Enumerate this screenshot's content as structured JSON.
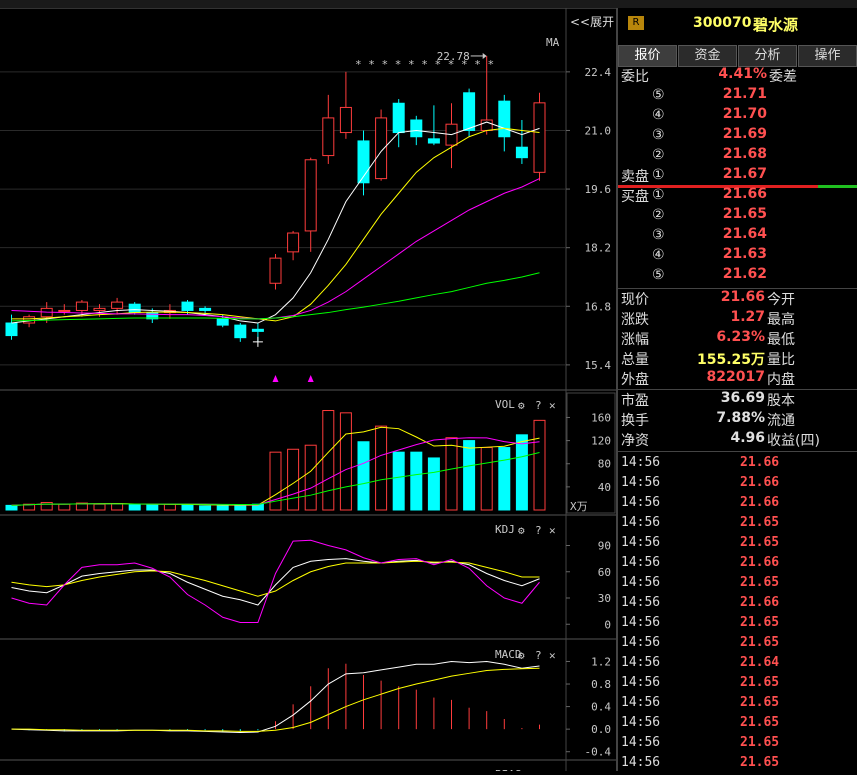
{
  "topbar": {
    "expand_label": "<<展开"
  },
  "stock": {
    "badge": "R",
    "code": "300070",
    "name": "碧水源"
  },
  "tabs": [
    {
      "label": "报价"
    },
    {
      "label": "资金"
    },
    {
      "label": "分析"
    },
    {
      "label": "操作"
    }
  ],
  "order_book": {
    "weibi_label": "委比",
    "weibi_value": "4.41%",
    "weicha_label": "委差",
    "sell_label": "卖盘",
    "buy_label": "买盘",
    "sells": [
      {
        "level": "⑤",
        "price": "21.71"
      },
      {
        "level": "④",
        "price": "21.70"
      },
      {
        "level": "③",
        "price": "21.69"
      },
      {
        "level": "②",
        "price": "21.68"
      },
      {
        "level": "①",
        "price": "21.67"
      }
    ],
    "buys": [
      {
        "level": "①",
        "price": "21.66"
      },
      {
        "level": "②",
        "price": "21.65"
      },
      {
        "level": "③",
        "price": "21.64"
      },
      {
        "level": "④",
        "price": "21.63"
      },
      {
        "level": "⑤",
        "price": "21.62"
      }
    ]
  },
  "quote": [
    {
      "label": "现价",
      "value": "21.66",
      "label2": "今开",
      "color": "red"
    },
    {
      "label": "涨跌",
      "value": "1.27",
      "label2": "最高",
      "color": "red"
    },
    {
      "label": "涨幅",
      "value": "6.23%",
      "label2": "最低",
      "color": "red"
    },
    {
      "label": "总量",
      "value": "155.25万",
      "label2": "量比",
      "color": "yellow"
    },
    {
      "label": "外盘",
      "value": "822017",
      "label2": "内盘",
      "color": "red"
    }
  ],
  "fundamentals": [
    {
      "label": "市盈",
      "value": "36.69",
      "label2": "股本"
    },
    {
      "label": "换手",
      "value": "7.88%",
      "label2": "流通"
    },
    {
      "label": "净资",
      "value": "4.96",
      "label2": "收益(四)"
    }
  ],
  "ticks": [
    {
      "time": "14:56",
      "price": "21.66"
    },
    {
      "time": "14:56",
      "price": "21.66"
    },
    {
      "time": "14:56",
      "price": "21.66"
    },
    {
      "time": "14:56",
      "price": "21.65"
    },
    {
      "time": "14:56",
      "price": "21.65"
    },
    {
      "time": "14:56",
      "price": "21.66"
    },
    {
      "time": "14:56",
      "price": "21.65"
    },
    {
      "time": "14:56",
      "price": "21.66"
    },
    {
      "time": "14:56",
      "price": "21.65"
    },
    {
      "time": "14:56",
      "price": "21.65"
    },
    {
      "time": "14:56",
      "price": "21.64"
    },
    {
      "time": "14:56",
      "price": "21.65"
    },
    {
      "time": "14:56",
      "price": "21.65"
    },
    {
      "time": "14:56",
      "price": "21.65"
    },
    {
      "time": "14:56",
      "price": "21.65"
    },
    {
      "time": "14:56",
      "price": "21.65"
    }
  ],
  "panels": {
    "main": {
      "title": "MA",
      "stars": "* * * * * * * * * * *",
      "high_annotation": "22.78",
      "yticks": [
        "22.4",
        "21.0",
        "19.6",
        "18.2",
        "16.8",
        "15.4"
      ]
    },
    "vol": {
      "title": "VOL",
      "yticks": [
        "160",
        "120",
        "80",
        "40"
      ],
      "unit": "X万"
    },
    "kdj": {
      "title": "KDJ",
      "yticks": [
        "90",
        "60",
        "30",
        "0"
      ]
    },
    "macd": {
      "title": "MACD",
      "yticks": [
        "1.2",
        "0.8",
        "0.4",
        "0.0",
        "-0.4"
      ]
    },
    "bias": {
      "title": "BIAS"
    }
  },
  "colors": {
    "up": "#ff3c3c",
    "down": "#00ffff",
    "ma5": "#ffffff",
    "ma10": "#ffff00",
    "ma20": "#ff00ff",
    "ma60": "#00ff00"
  },
  "chart_data": {
    "type": "candlestick",
    "ylim": [
      14.8,
      23.4
    ],
    "candles": [
      {
        "o": 16.4,
        "h": 16.6,
        "l": 16.0,
        "c": 16.1
      },
      {
        "o": 16.4,
        "h": 16.6,
        "l": 16.3,
        "c": 16.55
      },
      {
        "o": 16.55,
        "h": 16.9,
        "l": 16.4,
        "c": 16.75
      },
      {
        "o": 16.7,
        "h": 16.85,
        "l": 16.6,
        "c": 16.7
      },
      {
        "o": 16.7,
        "h": 16.95,
        "l": 16.55,
        "c": 16.9
      },
      {
        "o": 16.7,
        "h": 16.85,
        "l": 16.55,
        "c": 16.75
      },
      {
        "o": 16.75,
        "h": 17.0,
        "l": 16.6,
        "c": 16.9
      },
      {
        "o": 16.85,
        "h": 16.9,
        "l": 16.6,
        "c": 16.65
      },
      {
        "o": 16.65,
        "h": 16.75,
        "l": 16.4,
        "c": 16.5
      },
      {
        "o": 16.65,
        "h": 16.85,
        "l": 16.5,
        "c": 16.7
      },
      {
        "o": 16.9,
        "h": 16.95,
        "l": 16.6,
        "c": 16.7
      },
      {
        "o": 16.75,
        "h": 16.8,
        "l": 16.6,
        "c": 16.7
      },
      {
        "o": 16.5,
        "h": 16.6,
        "l": 16.3,
        "c": 16.35
      },
      {
        "o": 16.35,
        "h": 16.4,
        "l": 15.95,
        "c": 16.05
      },
      {
        "o": 16.25,
        "h": 16.4,
        "l": 15.95,
        "c": 16.2
      },
      {
        "o": 17.35,
        "h": 18.05,
        "l": 17.2,
        "c": 17.95
      },
      {
        "o": 18.1,
        "h": 18.6,
        "l": 17.9,
        "c": 18.55
      },
      {
        "o": 18.6,
        "h": 20.35,
        "l": 18.1,
        "c": 20.3
      },
      {
        "o": 20.4,
        "h": 21.85,
        "l": 20.2,
        "c": 21.3
      },
      {
        "o": 20.95,
        "h": 22.4,
        "l": 20.8,
        "c": 21.55
      },
      {
        "o": 20.75,
        "h": 21.0,
        "l": 19.45,
        "c": 19.75
      },
      {
        "o": 19.85,
        "h": 21.5,
        "l": 19.8,
        "c": 21.3
      },
      {
        "o": 21.65,
        "h": 21.75,
        "l": 20.6,
        "c": 20.95
      },
      {
        "o": 21.25,
        "h": 21.35,
        "l": 20.65,
        "c": 20.85
      },
      {
        "o": 20.8,
        "h": 21.6,
        "l": 20.65,
        "c": 20.7
      },
      {
        "o": 20.65,
        "h": 21.65,
        "l": 20.1,
        "c": 21.15
      },
      {
        "o": 21.9,
        "h": 22.0,
        "l": 20.85,
        "c": 21.0
      },
      {
        "o": 21.0,
        "h": 22.78,
        "l": 20.9,
        "c": 21.25
      },
      {
        "o": 21.7,
        "h": 21.85,
        "l": 20.5,
        "c": 20.85
      },
      {
        "o": 20.6,
        "h": 21.25,
        "l": 20.2,
        "c": 20.35
      },
      {
        "o": 20.0,
        "h": 21.9,
        "l": 19.8,
        "c": 21.66
      }
    ],
    "ma5": [
      16.4,
      16.45,
      16.5,
      16.55,
      16.6,
      16.65,
      16.7,
      16.72,
      16.7,
      16.68,
      16.65,
      16.6,
      16.55,
      16.45,
      16.4,
      16.6,
      17.0,
      17.6,
      18.4,
      19.3,
      19.9,
      20.5,
      20.95,
      21.0,
      20.95,
      20.9,
      21.05,
      21.2,
      21.05,
      20.9,
      21.05
    ],
    "ma10": [
      16.5,
      16.5,
      16.52,
      16.55,
      16.57,
      16.6,
      16.62,
      16.65,
      16.66,
      16.66,
      16.65,
      16.63,
      16.6,
      16.55,
      16.5,
      16.45,
      16.55,
      16.85,
      17.3,
      17.8,
      18.4,
      19.0,
      19.5,
      20.0,
      20.35,
      20.6,
      20.85,
      21.0,
      21.05,
      21.0,
      20.95
    ],
    "ma20": [
      16.7,
      16.68,
      16.66,
      16.65,
      16.64,
      16.63,
      16.62,
      16.62,
      16.61,
      16.6,
      16.6,
      16.58,
      16.55,
      16.52,
      16.5,
      16.52,
      16.58,
      16.7,
      16.9,
      17.15,
      17.45,
      17.75,
      18.05,
      18.35,
      18.6,
      18.85,
      19.1,
      19.3,
      19.5,
      19.65,
      19.85
    ],
    "ma60": [
      16.45,
      16.46,
      16.47,
      16.48,
      16.49,
      16.5,
      16.51,
      16.52,
      16.52,
      16.52,
      16.52,
      16.52,
      16.51,
      16.5,
      16.5,
      16.52,
      16.55,
      16.6,
      16.65,
      16.72,
      16.78,
      16.85,
      16.92,
      17.0,
      17.08,
      17.15,
      17.25,
      17.35,
      17.42,
      17.5,
      17.6
    ],
    "volume": [
      8,
      10,
      13,
      10,
      12,
      10,
      11,
      9,
      9,
      10,
      10,
      7,
      7,
      8,
      10,
      100,
      105,
      112,
      172,
      168,
      118,
      145,
      100,
      100,
      90,
      125,
      120,
      108,
      108,
      130,
      155
    ],
    "vol_ylim": [
      0,
      185
    ],
    "kdj_k": [
      42,
      38,
      36,
      45,
      55,
      58,
      60,
      62,
      62,
      58,
      48,
      40,
      32,
      28,
      22,
      45,
      65,
      72,
      74,
      75,
      72,
      70,
      72,
      73,
      70,
      72,
      68,
      58,
      50,
      44,
      52
    ],
    "kdj_d": [
      48,
      45,
      43,
      45,
      50,
      54,
      57,
      60,
      61,
      60,
      55,
      50,
      44,
      38,
      32,
      38,
      50,
      60,
      66,
      70,
      70,
      70,
      71,
      72,
      71,
      71,
      70,
      65,
      60,
      54,
      54
    ],
    "kdj_j": [
      30,
      24,
      22,
      45,
      65,
      68,
      68,
      70,
      64,
      54,
      34,
      22,
      8,
      2,
      2,
      58,
      95,
      96,
      90,
      85,
      76,
      70,
      74,
      75,
      68,
      74,
      64,
      44,
      30,
      24,
      48
    ],
    "kdj_ylim": [
      -10,
      110
    ],
    "macd_dif": [
      0.0,
      -0.01,
      -0.02,
      -0.03,
      -0.03,
      -0.03,
      -0.03,
      -0.02,
      -0.02,
      -0.03,
      -0.03,
      -0.04,
      -0.05,
      -0.06,
      -0.05,
      0.05,
      0.25,
      0.5,
      0.8,
      0.98,
      1.0,
      1.05,
      1.1,
      1.15,
      1.15,
      1.2,
      1.18,
      1.2,
      1.15,
      1.08,
      1.12
    ],
    "macd_dea": [
      0.0,
      0.0,
      -0.01,
      -0.01,
      -0.02,
      -0.02,
      -0.02,
      -0.02,
      -0.02,
      -0.02,
      -0.02,
      -0.03,
      -0.03,
      -0.04,
      -0.04,
      -0.02,
      0.03,
      0.12,
      0.26,
      0.4,
      0.52,
      0.62,
      0.72,
      0.8,
      0.87,
      0.94,
      0.99,
      1.04,
      1.06,
      1.07,
      1.08
    ],
    "macd_hist": [
      0.0,
      -0.02,
      -0.02,
      -0.04,
      -0.02,
      -0.02,
      -0.02,
      0.0,
      0.0,
      -0.02,
      -0.02,
      -0.02,
      -0.04,
      -0.04,
      -0.02,
      0.14,
      0.44,
      0.76,
      1.08,
      1.16,
      0.96,
      0.86,
      0.76,
      0.7,
      0.56,
      0.52,
      0.38,
      0.32,
      0.18,
      0.02,
      0.08
    ],
    "macd_ylim": [
      -0.6,
      1.35
    ]
  }
}
